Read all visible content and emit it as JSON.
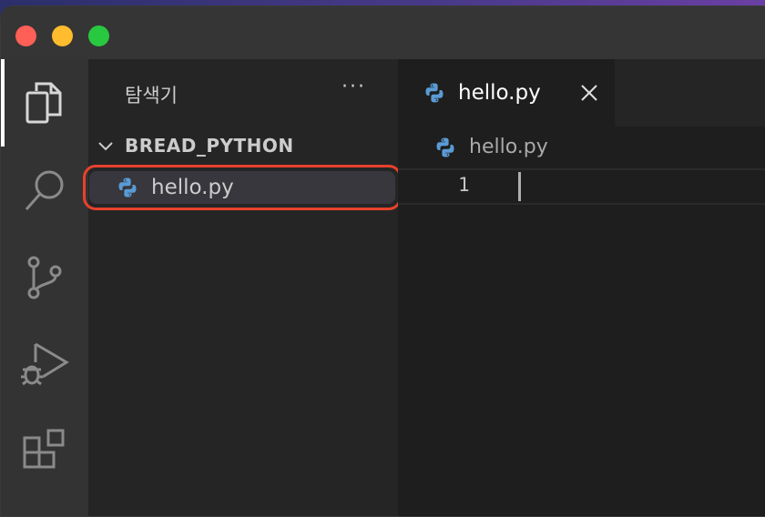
{
  "explorer": {
    "title": "탐색기",
    "more_label": "···",
    "folder_name": "BREAD_PYTHON",
    "files": [
      {
        "name": "hello.py",
        "icon": "python-file-icon",
        "selected": true
      }
    ]
  },
  "editor": {
    "tab_label": "hello.py",
    "breadcrumb_file": "hello.py",
    "line_number": "1"
  },
  "colors": {
    "highlight": "#e8412c",
    "python_blue": "#5a9bd5"
  }
}
